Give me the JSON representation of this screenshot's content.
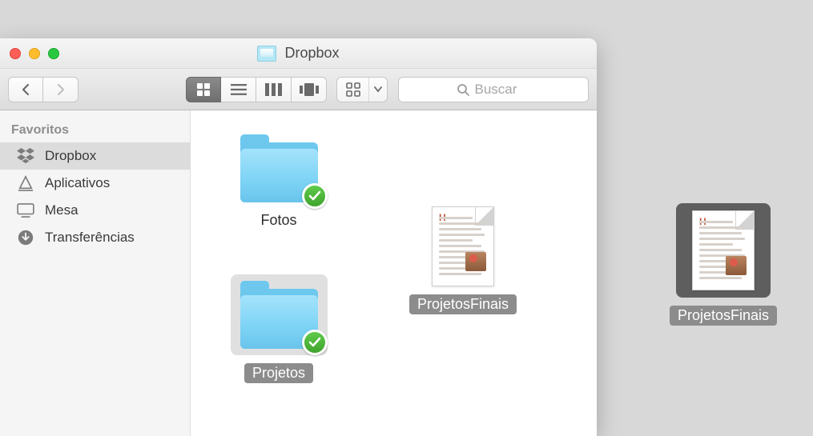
{
  "window": {
    "title": "Dropbox"
  },
  "toolbar": {
    "search_placeholder": "Buscar"
  },
  "sidebar": {
    "section_header": "Favoritos",
    "items": [
      {
        "label": "Dropbox",
        "icon": "dropbox-icon",
        "active": true
      },
      {
        "label": "Aplicativos",
        "icon": "apps-icon",
        "active": false
      },
      {
        "label": "Mesa",
        "icon": "desktop-icon",
        "active": false
      },
      {
        "label": "Transferências",
        "icon": "downloads-icon",
        "active": false
      }
    ]
  },
  "content": {
    "items": [
      {
        "name": "Fotos",
        "type": "folder",
        "synced": true,
        "selected": false
      },
      {
        "name": "ProjetosFinais",
        "type": "document",
        "synced": false,
        "selected": true
      },
      {
        "name": "Projetos",
        "type": "folder",
        "synced": true,
        "selected": true
      }
    ]
  },
  "desktop": {
    "dragged_file": {
      "name": "ProjetosFinais",
      "type": "document",
      "selected": true
    }
  }
}
